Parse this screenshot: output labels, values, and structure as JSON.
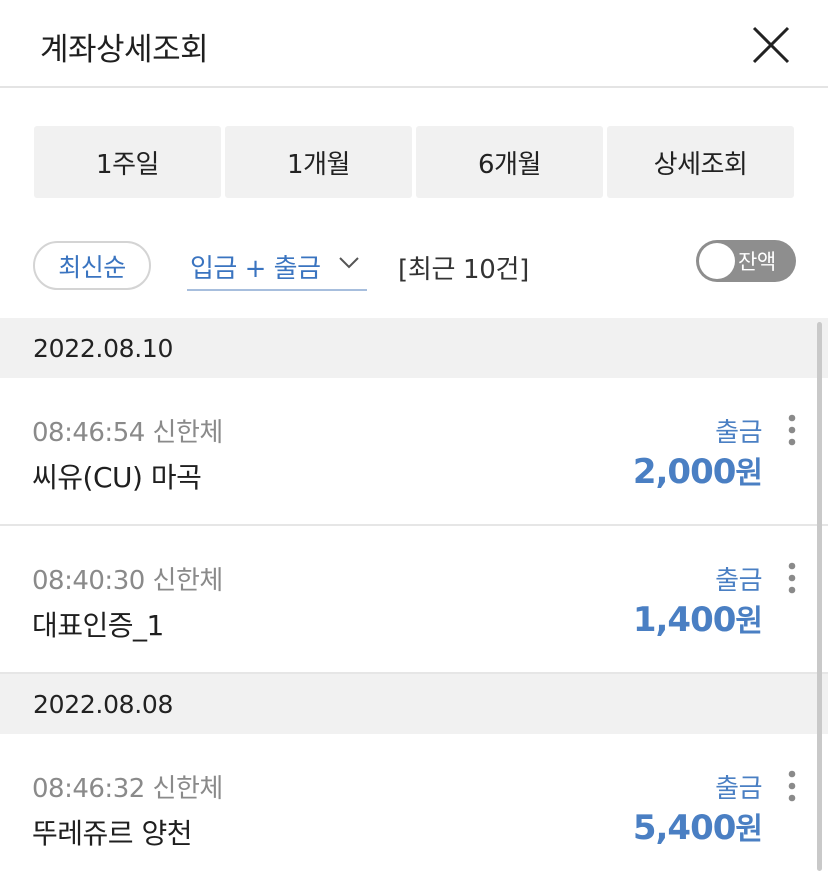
{
  "header": {
    "title": "계좌상세조회",
    "close_icon": "close-icon"
  },
  "tabs": [
    {
      "label": "1주일"
    },
    {
      "label": "1개월"
    },
    {
      "label": "6개월"
    },
    {
      "label": "상세조회"
    }
  ],
  "filters": {
    "sort_label": "최신순",
    "type_label": "입금 + 출금",
    "type_icon": "chevron-down-icon",
    "count_label": "[최근 10건]",
    "balance_toggle_label": "잔액",
    "balance_toggle_on": false
  },
  "groups": [
    {
      "date": "2022.08.10",
      "transactions": [
        {
          "time_bank": "08:46:54 신한체",
          "merchant": "씨유(CU) 마곡",
          "type": "출금",
          "amount": "2,000",
          "unit": "원"
        },
        {
          "time_bank": "08:40:30 신한체",
          "merchant": "대표인증_1",
          "type": "출금",
          "amount": "1,400",
          "unit": "원"
        }
      ]
    },
    {
      "date": "2022.08.08",
      "transactions": [
        {
          "time_bank": "08:46:32 신한체",
          "merchant": "뚜레쥬르 양천",
          "type": "출금",
          "amount": "5,400",
          "unit": "원"
        }
      ]
    }
  ],
  "colors": {
    "accent": "#4a7fc3",
    "date_bg": "#f1f1f1",
    "toggle_off": "#8e8e8e"
  }
}
